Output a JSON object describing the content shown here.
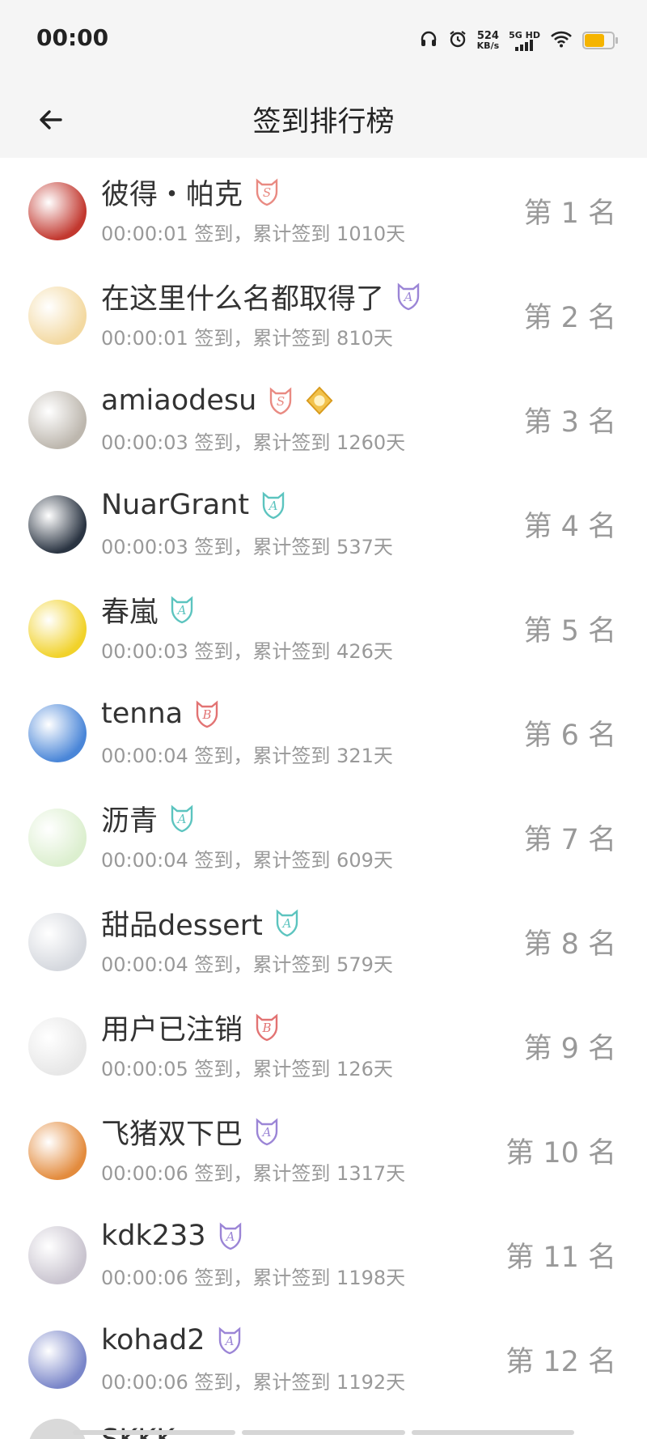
{
  "status": {
    "time": "00:00",
    "net_speed": "524",
    "net_unit": "KB/s",
    "network": "5G HD"
  },
  "header": {
    "title": "签到排行榜"
  },
  "colors": {
    "s_badge": "#e98a82",
    "a_badge_purple": "#9b85d6",
    "a_badge_teal": "#5cc4bf",
    "b_badge": "#e27373",
    "vip_gold": "#f2c24b"
  },
  "rows": [
    {
      "name": "彼得・帕克",
      "badges": [
        "S"
      ],
      "detail": "00:00:01 签到，累计签到 1010天",
      "rank": "第 1 名",
      "avatar": "#c2382f"
    },
    {
      "name": "在这里什么名都取得了",
      "badges": [
        "A-purple"
      ],
      "detail": "00:00:01 签到，累计签到 810天",
      "rank": "第 2 名",
      "avatar": "#f3d9a1"
    },
    {
      "name": "amiaodesu",
      "badges": [
        "S",
        "VIP-gold"
      ],
      "detail": "00:00:03 签到，累计签到 1260天",
      "rank": "第 3 名",
      "avatar": "#bdb7ae"
    },
    {
      "name": "NuarGrant",
      "badges": [
        "A-teal"
      ],
      "detail": "00:00:03 签到，累计签到 537天",
      "rank": "第 4 名",
      "avatar": "#2a3442"
    },
    {
      "name": "春嵐",
      "badges": [
        "A-teal"
      ],
      "detail": "00:00:03 签到，累计签到 426天",
      "rank": "第 5 名",
      "avatar": "#f1d22a"
    },
    {
      "name": "tenna",
      "badges": [
        "B"
      ],
      "detail": "00:00:04 签到，累计签到 321天",
      "rank": "第 6 名",
      "avatar": "#4a86d8"
    },
    {
      "name": "沥青",
      "badges": [
        "A-teal"
      ],
      "detail": "00:00:04 签到，累计签到 609天",
      "rank": "第 7 名",
      "avatar": "#dcefcf"
    },
    {
      "name": "甜品dessert",
      "badges": [
        "A-teal"
      ],
      "detail": "00:00:04 签到，累计签到 579天",
      "rank": "第 8 名",
      "avatar": "#d5d8de"
    },
    {
      "name": "用户已注销",
      "badges": [
        "B"
      ],
      "detail": "00:00:05 签到，累计签到 126天",
      "rank": "第 9 名",
      "avatar": "#e7e7e7"
    },
    {
      "name": "飞猪双下巴",
      "badges": [
        "A-purple"
      ],
      "detail": "00:00:06 签到，累计签到 1317天",
      "rank": "第 10 名",
      "avatar": "#e38b3d"
    },
    {
      "name": "kdk233",
      "badges": [
        "A-purple"
      ],
      "detail": "00:00:06 签到，累计签到 1198天",
      "rank": "第 11 名",
      "avatar": "#c9c4cf"
    },
    {
      "name": "kohad2",
      "badges": [
        "A-purple"
      ],
      "detail": "00:00:06 签到，累计签到 1192天",
      "rank": "第 12 名",
      "avatar": "#7a86c9"
    }
  ],
  "partial_row": {
    "name": "SKKK"
  }
}
